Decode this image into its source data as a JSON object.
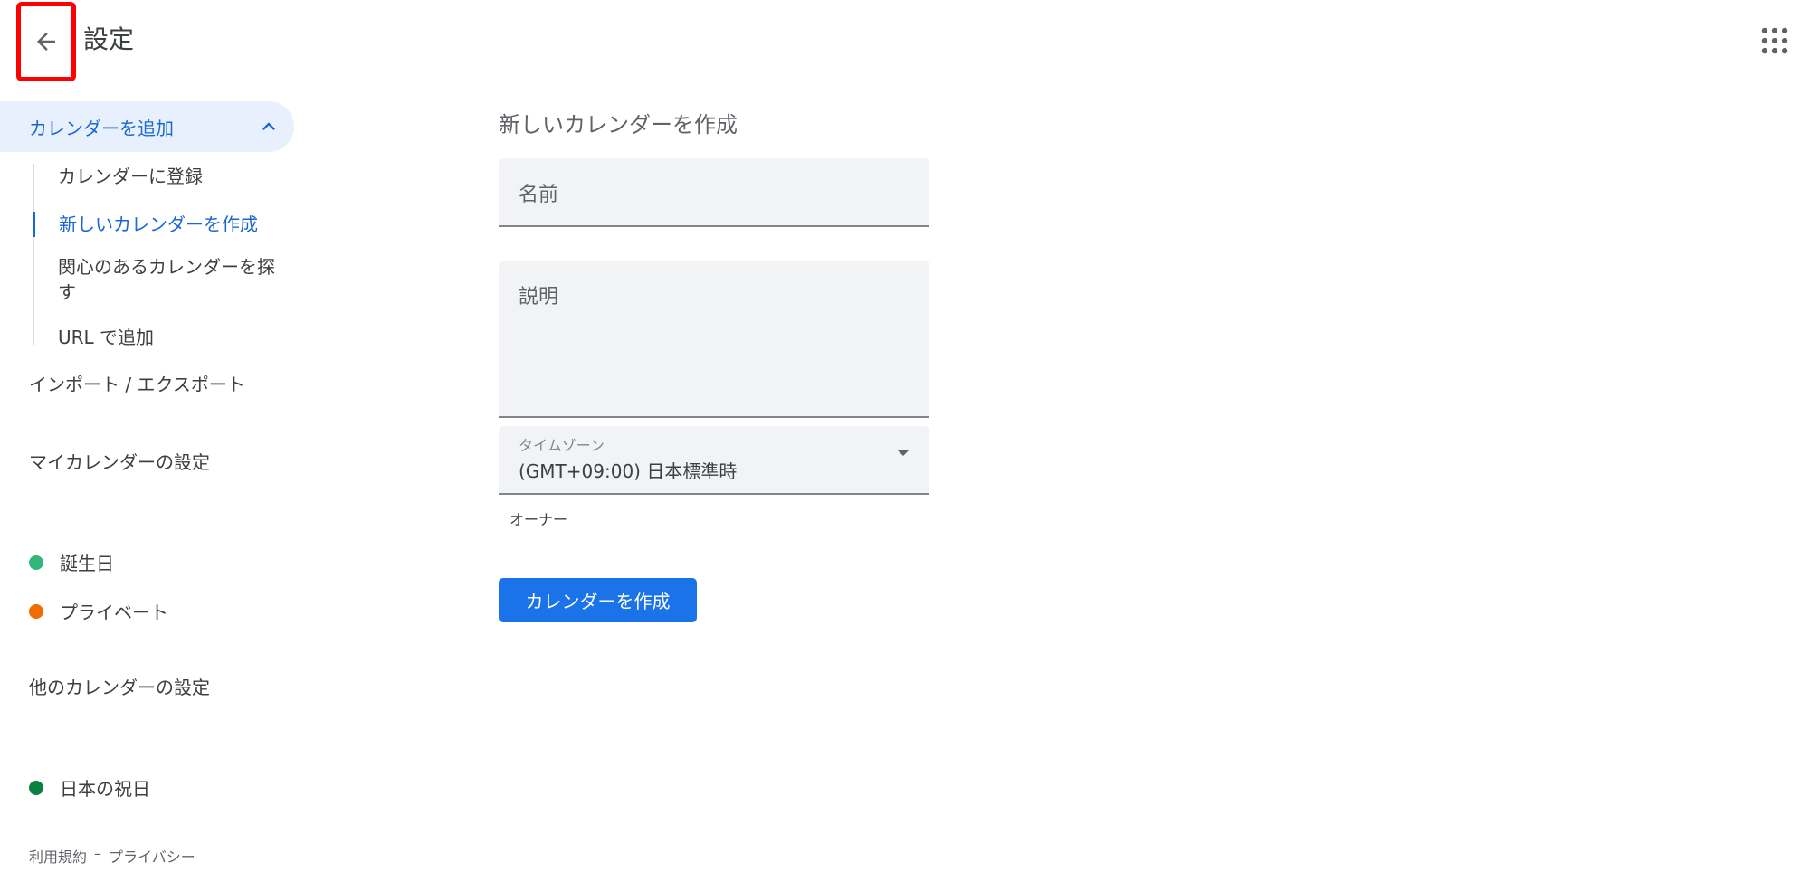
{
  "header": {
    "title": "設定"
  },
  "sidebar": {
    "add_calendar": {
      "label": "カレンダーを追加",
      "items": [
        {
          "label": "カレンダーに登録"
        },
        {
          "label": "新しいカレンダーを作成"
        },
        {
          "label": "関心のあるカレンダーを探す"
        },
        {
          "label": "URL で追加"
        }
      ]
    },
    "import_export": "インポート / エクスポート",
    "my_calendars_heading": "マイカレンダーの設定",
    "my_calendars": [
      {
        "label": "誕生日",
        "color": "#33b679"
      },
      {
        "label": "プライベート",
        "color": "#ef6c00"
      }
    ],
    "other_calendars_heading": "他のカレンダーの設定",
    "other_calendars": [
      {
        "label": "日本の祝日",
        "color": "#0b8043"
      }
    ],
    "footer": {
      "terms": "利用規約",
      "separator": "–",
      "privacy": "プライバシー"
    }
  },
  "main": {
    "title": "新しいカレンダーを作成",
    "name_field": {
      "label": "名前"
    },
    "description_field": {
      "label": "説明"
    },
    "timezone_field": {
      "label": "タイムゾーン",
      "value": "(GMT+09:00) 日本標準時"
    },
    "owner_label": "オーナー",
    "create_button": "カレンダーを作成"
  },
  "colors": {
    "accent": "#1a73e8",
    "nav_active_bg": "#e8f0fe",
    "nav_active_text": "#1967d2"
  }
}
